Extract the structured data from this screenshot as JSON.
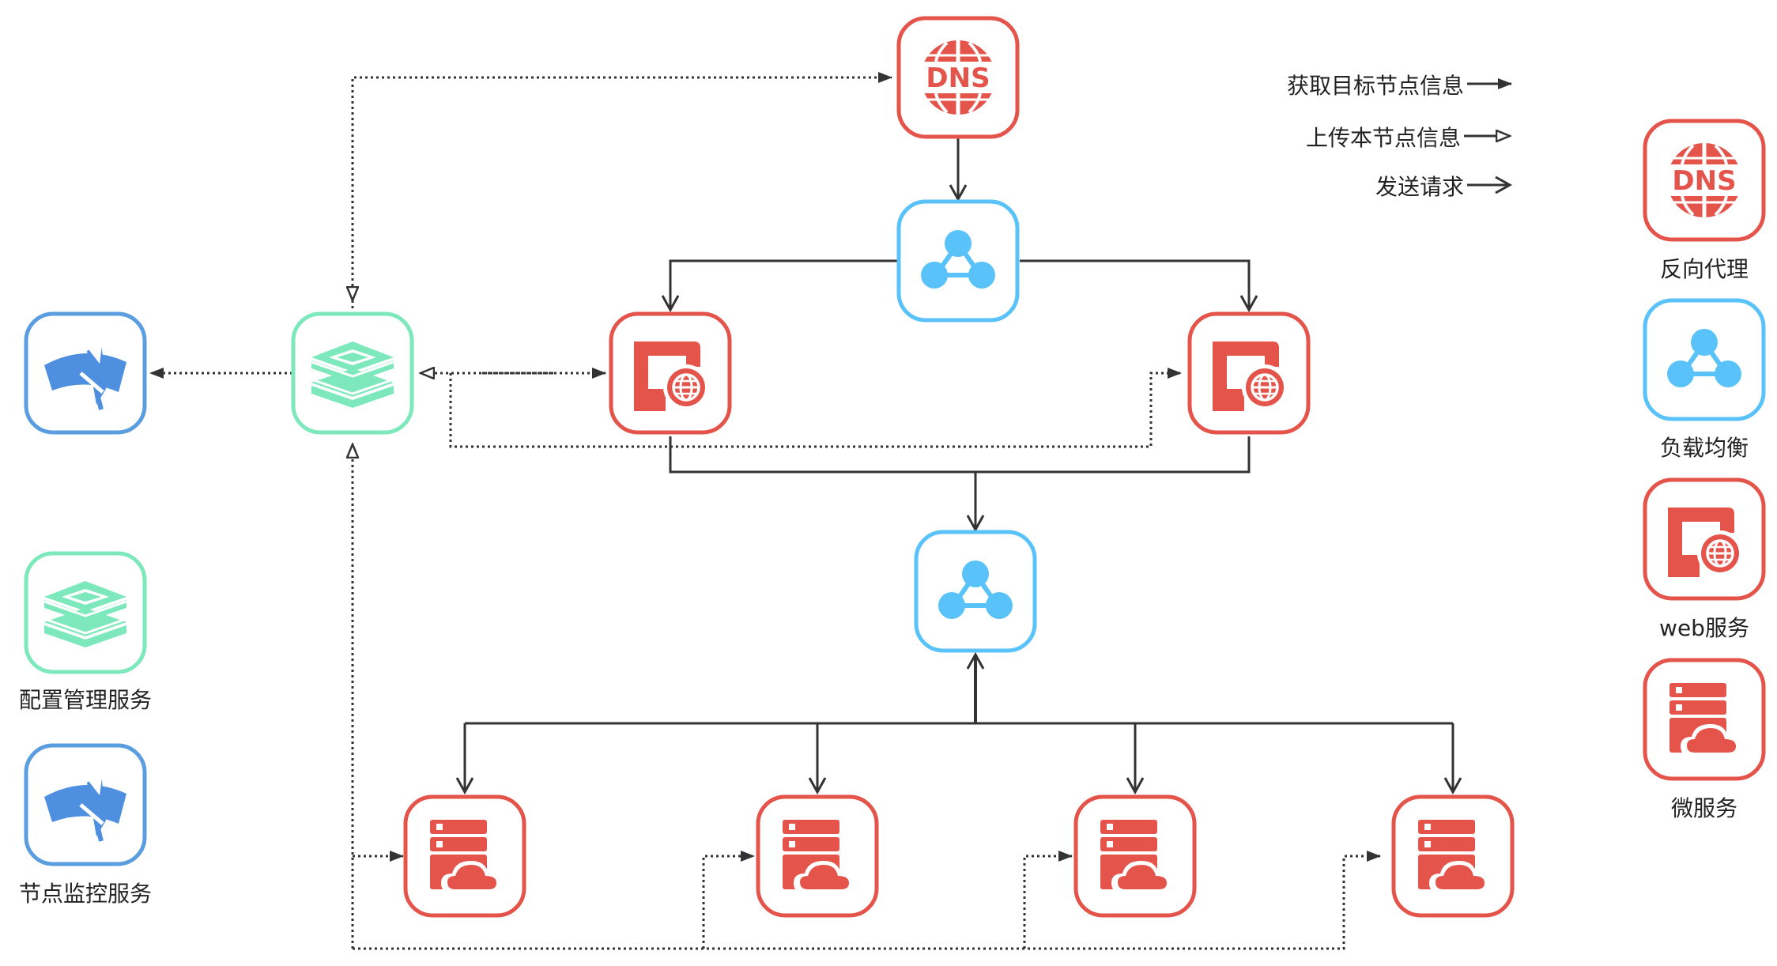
{
  "legend": {
    "fetch": "获取目标节点信息",
    "upload": "上传本节点信息",
    "send": "发送请求"
  },
  "labels": {
    "dns": "反向代理",
    "lb": "负载均衡",
    "web": "web服务",
    "micro": "微服务",
    "config": "配置管理服务",
    "monitor": "节点监控服务"
  },
  "dns_text": "DNS",
  "colors": {
    "red": "#e5544b",
    "blue": "#59c2f8",
    "green": "#7ee8bd",
    "mon_border": "#5b9ee0",
    "mon_fill": "#4e90df",
    "line": "#333333"
  },
  "icons": {
    "dns": "dns-globe-icon",
    "lb": "load-balancer-icon",
    "web": "web-monitor-globe-icon",
    "micro": "server-cloud-icon",
    "config": "stacked-layers-icon",
    "monitor": "gauge-monitor-icon"
  }
}
